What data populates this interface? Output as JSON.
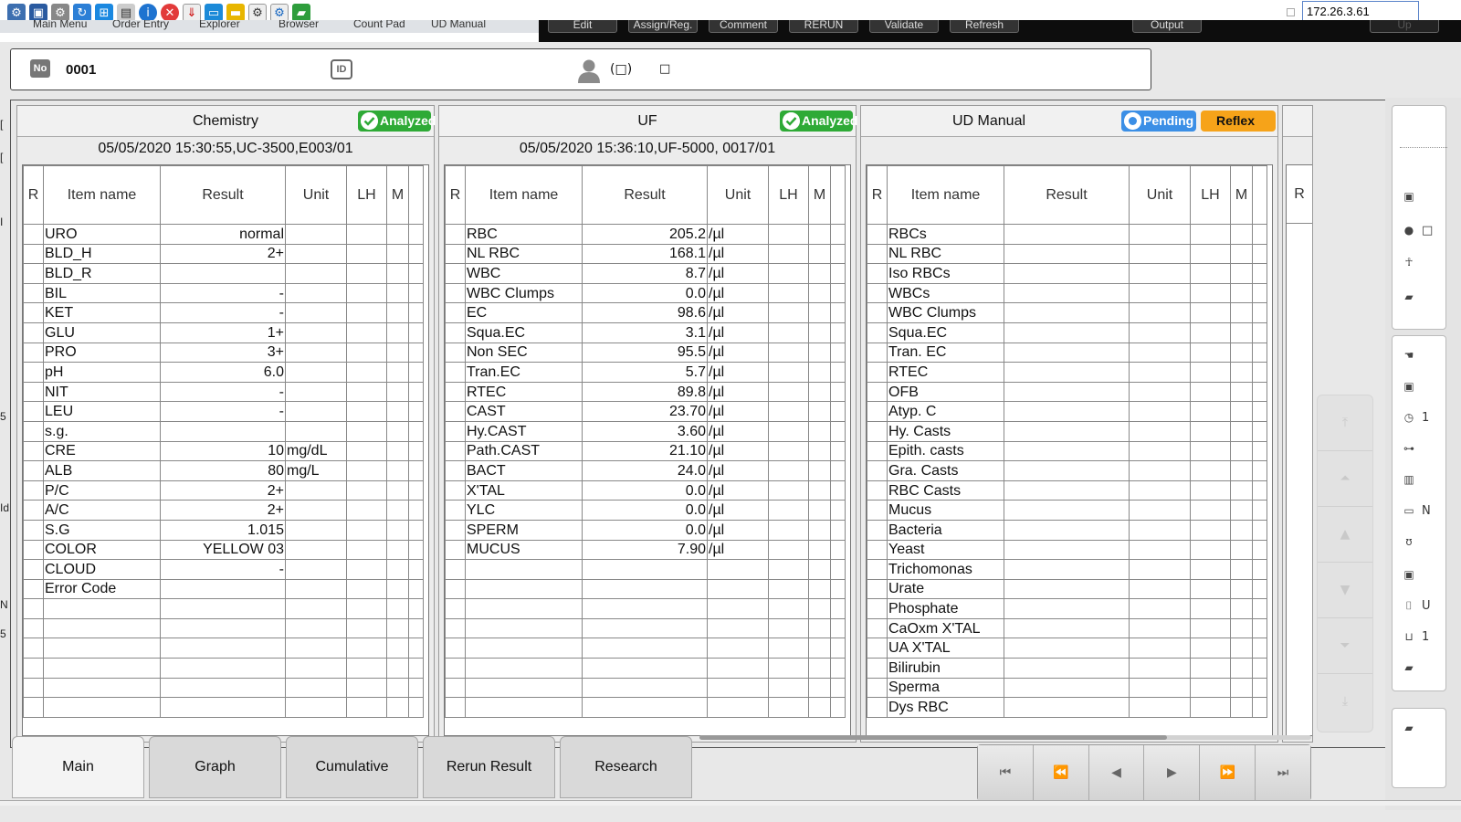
{
  "toolbar": {
    "icons": [
      "network-icon",
      "fullscreen-icon",
      "gear-icon",
      "refresh-icon",
      "windows-icon",
      "document-icon",
      "info-icon",
      "close-icon",
      "download-icon",
      "monitor-icon",
      "folder-icon",
      "settings-icon",
      "remote-icon",
      "chat-icon"
    ],
    "ip_address": "172.26.3.61"
  },
  "menu": {
    "items": [
      "Main Menu",
      "Order Entry",
      "Explorer",
      "Browser",
      "Count Pad",
      "UD Manual"
    ]
  },
  "actions": {
    "items": [
      "Edit",
      "Assign/Reg.",
      "Comment",
      "RERUN",
      "Validate",
      "Refresh",
      "Output",
      "Up"
    ]
  },
  "sample": {
    "no_label": "No",
    "number": "0001",
    "id_label": "ID",
    "patient_name": "(□)",
    "patient_extra": "□"
  },
  "panels": {
    "chemistry": {
      "title": "Chemistry",
      "status": "Analyzed",
      "subtitle": "05/05/2020 15:30:55,UC-3500,E003/01",
      "headers": [
        "R",
        "Item name",
        "Result",
        "Unit",
        "LH",
        "M"
      ],
      "rows": [
        {
          "name": "URO",
          "result": "normal",
          "unit": ""
        },
        {
          "name": "BLD_H",
          "result": "2+",
          "unit": ""
        },
        {
          "name": "BLD_R",
          "result": "",
          "unit": ""
        },
        {
          "name": "BIL",
          "result": "-",
          "unit": ""
        },
        {
          "name": "KET",
          "result": "-",
          "unit": ""
        },
        {
          "name": "GLU",
          "result": "1+",
          "unit": ""
        },
        {
          "name": "PRO",
          "result": "3+",
          "unit": ""
        },
        {
          "name": "pH",
          "result": "6.0",
          "unit": ""
        },
        {
          "name": "NIT",
          "result": "-",
          "unit": ""
        },
        {
          "name": "LEU",
          "result": "-",
          "unit": ""
        },
        {
          "name": "s.g.",
          "result": "",
          "unit": ""
        },
        {
          "name": "CRE",
          "result": "10",
          "unit": "mg/dL"
        },
        {
          "name": "ALB",
          "result": "80",
          "unit": "mg/L"
        },
        {
          "name": "P/C",
          "result": "2+",
          "unit": ""
        },
        {
          "name": "A/C",
          "result": "2+",
          "unit": ""
        },
        {
          "name": "S.G",
          "result": "1.015",
          "unit": ""
        },
        {
          "name": "COLOR",
          "result": "YELLOW     03",
          "unit": ""
        },
        {
          "name": "CLOUD",
          "result": "-",
          "unit": ""
        },
        {
          "name": "Error Code",
          "result": "",
          "unit": ""
        },
        {
          "name": "",
          "result": "",
          "unit": ""
        },
        {
          "name": "",
          "result": "",
          "unit": ""
        },
        {
          "name": "",
          "result": "",
          "unit": ""
        },
        {
          "name": "",
          "result": "",
          "unit": ""
        },
        {
          "name": "",
          "result": "",
          "unit": ""
        },
        {
          "name": "",
          "result": "",
          "unit": ""
        }
      ]
    },
    "uf": {
      "title": "UF",
      "status": "Analyzed",
      "subtitle": "05/05/2020 15:36:10,UF-5000,  0017/01",
      "headers": [
        "R",
        "Item name",
        "Result",
        "Unit",
        "LH",
        "M"
      ],
      "rows": [
        {
          "name": "RBC",
          "result": "205.2",
          "unit": "/µl"
        },
        {
          "name": "NL RBC",
          "result": "168.1",
          "unit": "/µl"
        },
        {
          "name": "WBC",
          "result": "8.7",
          "unit": "/µl"
        },
        {
          "name": "WBC Clumps",
          "result": "0.0",
          "unit": "/µl"
        },
        {
          "name": "EC",
          "result": "98.6",
          "unit": "/µl"
        },
        {
          "name": "Squa.EC",
          "result": "3.1",
          "unit": "/µl"
        },
        {
          "name": "Non SEC",
          "result": "95.5",
          "unit": "/µl"
        },
        {
          "name": "Tran.EC",
          "result": "5.7",
          "unit": "/µl"
        },
        {
          "name": "RTEC",
          "result": "89.8",
          "unit": "/µl"
        },
        {
          "name": "CAST",
          "result": "23.70",
          "unit": "/µl"
        },
        {
          "name": "Hy.CAST",
          "result": "3.60",
          "unit": "/µl"
        },
        {
          "name": "Path.CAST",
          "result": "21.10",
          "unit": "/µl"
        },
        {
          "name": "BACT",
          "result": "24.0",
          "unit": "/µl"
        },
        {
          "name": "X'TAL",
          "result": "0.0",
          "unit": "/µl"
        },
        {
          "name": "YLC",
          "result": "0.0",
          "unit": "/µl"
        },
        {
          "name": "SPERM",
          "result": "0.0",
          "unit": "/µl"
        },
        {
          "name": "MUCUS",
          "result": "7.90",
          "unit": "/µl"
        },
        {
          "name": "",
          "result": "",
          "unit": ""
        },
        {
          "name": "",
          "result": "",
          "unit": ""
        },
        {
          "name": "",
          "result": "",
          "unit": ""
        },
        {
          "name": "",
          "result": "",
          "unit": ""
        },
        {
          "name": "",
          "result": "",
          "unit": ""
        },
        {
          "name": "",
          "result": "",
          "unit": ""
        },
        {
          "name": "",
          "result": "",
          "unit": ""
        },
        {
          "name": "",
          "result": "",
          "unit": ""
        }
      ]
    },
    "ud_manual": {
      "title": "UD Manual",
      "status": "Pending",
      "reflex": "Reflex",
      "subtitle": "",
      "headers": [
        "R",
        "Item name",
        "Result",
        "Unit",
        "LH",
        "M"
      ],
      "rows": [
        {
          "name": "RBCs",
          "result": "",
          "unit": ""
        },
        {
          "name": "NL RBC",
          "result": "",
          "unit": ""
        },
        {
          "name": "Iso RBCs",
          "result": "",
          "unit": ""
        },
        {
          "name": "WBCs",
          "result": "",
          "unit": ""
        },
        {
          "name": "WBC Clumps",
          "result": "",
          "unit": ""
        },
        {
          "name": "Squa.EC",
          "result": "",
          "unit": ""
        },
        {
          "name": "Tran. EC",
          "result": "",
          "unit": ""
        },
        {
          "name": "RTEC",
          "result": "",
          "unit": ""
        },
        {
          "name": "OFB",
          "result": "",
          "unit": ""
        },
        {
          "name": "Atyp. C",
          "result": "",
          "unit": ""
        },
        {
          "name": "Hy. Casts",
          "result": "",
          "unit": ""
        },
        {
          "name": "Epith. casts",
          "result": "",
          "unit": ""
        },
        {
          "name": "Gra. Casts",
          "result": "",
          "unit": ""
        },
        {
          "name": "RBC Casts",
          "result": "",
          "unit": ""
        },
        {
          "name": "Mucus",
          "result": "",
          "unit": ""
        },
        {
          "name": "Bacteria",
          "result": "",
          "unit": ""
        },
        {
          "name": "Yeast",
          "result": "",
          "unit": ""
        },
        {
          "name": "Trichomonas",
          "result": "",
          "unit": ""
        },
        {
          "name": "Urate",
          "result": "",
          "unit": ""
        },
        {
          "name": "Phosphate",
          "result": "",
          "unit": ""
        },
        {
          "name": "CaOxm X'TAL",
          "result": "",
          "unit": ""
        },
        {
          "name": "UA X'TAL",
          "result": "",
          "unit": ""
        },
        {
          "name": "Bilirubin",
          "result": "",
          "unit": ""
        },
        {
          "name": "Sperma",
          "result": "",
          "unit": ""
        },
        {
          "name": "Dys RBC",
          "result": "",
          "unit": ""
        }
      ]
    },
    "partial": {
      "header_r": "R"
    }
  },
  "left_edge": [
    "[",
    "[",
    "I",
    "5",
    "Id",
    "N",
    "5"
  ],
  "sidebar": {
    "top_items": [
      {
        "icon": "id-icon",
        "text": ""
      },
      {
        "icon": "person-icon",
        "text": "□"
      },
      {
        "icon": "body-icon",
        "text": ""
      },
      {
        "icon": "comment-icon",
        "text": ""
      }
    ],
    "middle_items": [
      {
        "icon": "hand-icon",
        "text": ""
      },
      {
        "icon": "number-icon",
        "text": ""
      },
      {
        "icon": "clock-icon",
        "text": "1"
      },
      {
        "icon": "flow-icon",
        "text": ""
      },
      {
        "icon": "building-icon",
        "text": ""
      },
      {
        "icon": "bed-icon",
        "text": "N"
      },
      {
        "icon": "stethoscope-icon",
        "text": ""
      },
      {
        "icon": "number-icon",
        "text": ""
      },
      {
        "icon": "tube-icon",
        "text": "U"
      },
      {
        "icon": "cup-icon",
        "text": "1"
      },
      {
        "icon": "comment-icon",
        "text": ""
      }
    ],
    "bottom_items": [
      {
        "icon": "comment-icon",
        "text": ""
      }
    ]
  },
  "tabs": [
    "Main",
    "Graph",
    "Cumulative",
    "Rerun Result",
    "Research"
  ],
  "active_tab": "Main",
  "colors": {
    "analyzed": "#2eaa36",
    "pending": "#3b8fe6",
    "reflex": "#f6a319"
  }
}
